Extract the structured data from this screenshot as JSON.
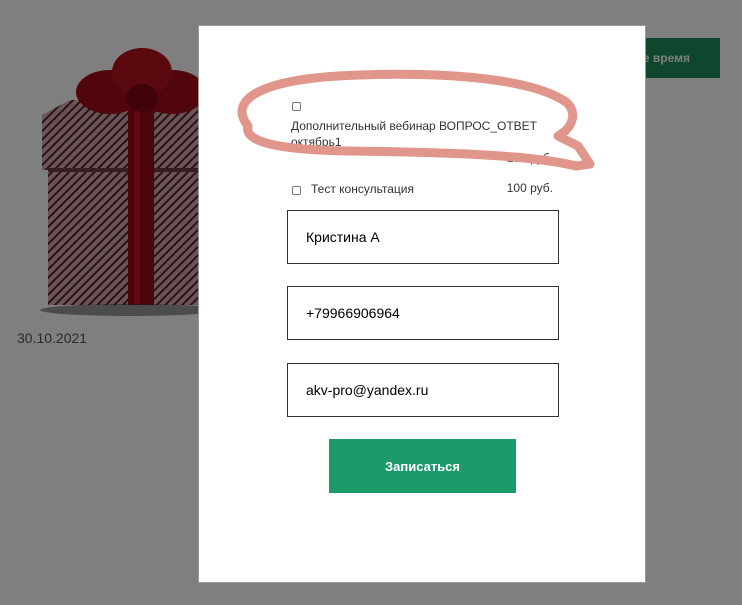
{
  "background": {
    "date": "30.10.2021",
    "button_label": "е время"
  },
  "modal": {
    "options": [
      {
        "label": "Дополнительный вебинар ВОПРОС_ОТВЕТ октябрь1",
        "price": "100 руб.",
        "checked": false
      },
      {
        "label": "Тест консультация",
        "price": "100 руб.",
        "checked": false
      }
    ],
    "fields": {
      "name": "Кристина А",
      "phone": "+79966906964",
      "email": "akv-pro@yandex.ru"
    },
    "submit_label": "Записаться"
  },
  "colors": {
    "accent": "#1d9a6a",
    "overlay": "#808080",
    "annotation": "#e0968a"
  },
  "icons": [
    "gift-box-image",
    "checkbox-icon"
  ]
}
